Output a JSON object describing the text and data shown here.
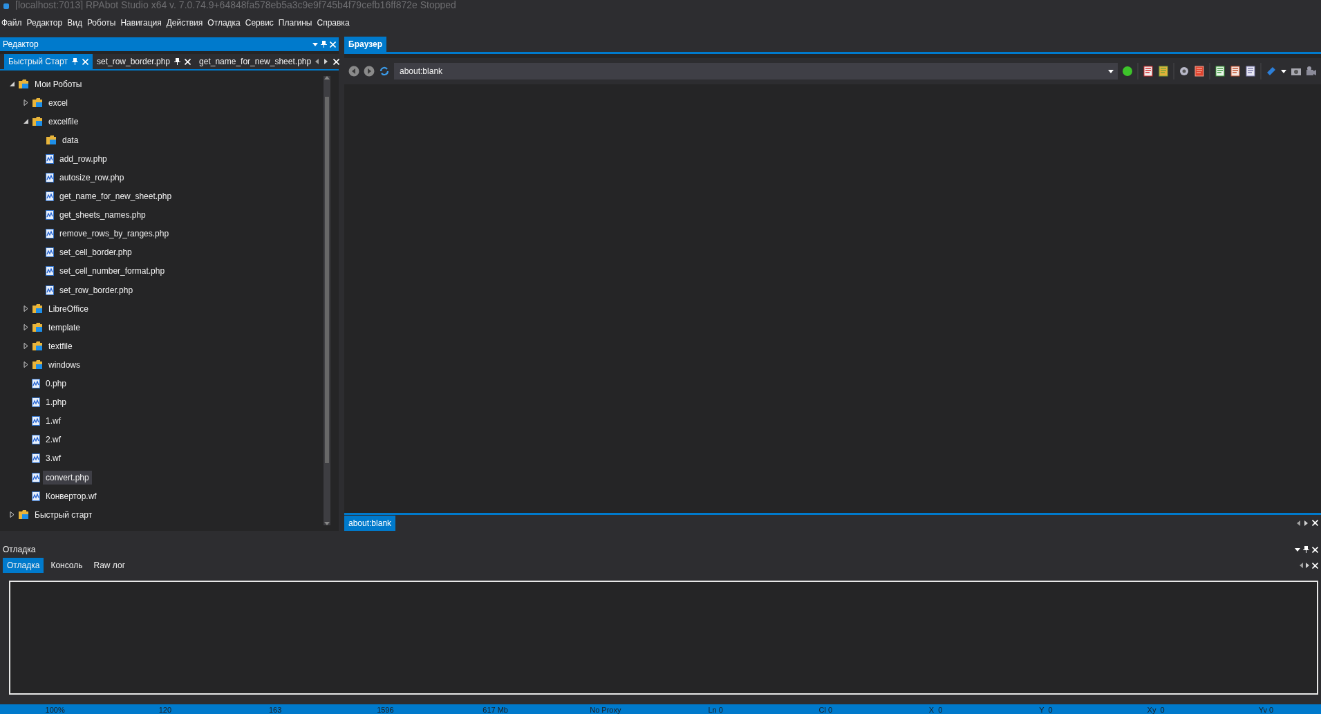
{
  "window": {
    "title": "[localhost:7013] RPAbot Studio x64 v. 7.0.74.9+64848fa578eb5a3c9e9f745b4f79cefb16ff872e Stopped"
  },
  "menu": [
    "Файл",
    "Редактор",
    "Вид",
    "Роботы",
    "Навигация",
    "Действия",
    "Отладка",
    "Сервис",
    "Плагины",
    "Справка"
  ],
  "editor": {
    "title": "Редактор",
    "tabs": [
      {
        "label": "Быстрый Старт",
        "selected": true,
        "pinned": true,
        "closable": true
      },
      {
        "label": "set_row_border.php",
        "selected": false,
        "pinned": true,
        "closable": true
      },
      {
        "label": "get_name_for_new_sheet.php",
        "selected": false,
        "pinned": false,
        "closable": false
      }
    ],
    "tree": [
      {
        "label": "Мои Роботы",
        "kind": "folder",
        "expanded": true,
        "selected": false,
        "children": [
          {
            "label": "excel",
            "kind": "folder",
            "expanded": false,
            "selected": false
          },
          {
            "label": "excelfile",
            "kind": "folder",
            "expanded": true,
            "selected": false,
            "children": [
              {
                "label": "data",
                "kind": "folder",
                "selected": false
              },
              {
                "label": "add_row.php",
                "kind": "file",
                "selected": false
              },
              {
                "label": "autosize_row.php",
                "kind": "file",
                "selected": false
              },
              {
                "label": "get_name_for_new_sheet.php",
                "kind": "file",
                "selected": false
              },
              {
                "label": "get_sheets_names.php",
                "kind": "file",
                "selected": false
              },
              {
                "label": "remove_rows_by_ranges.php",
                "kind": "file",
                "selected": false
              },
              {
                "label": "set_cell_border.php",
                "kind": "file",
                "selected": false
              },
              {
                "label": "set_cell_number_format.php",
                "kind": "file",
                "selected": false
              },
              {
                "label": "set_row_border.php",
                "kind": "file",
                "selected": false
              }
            ]
          },
          {
            "label": "LibreOffice",
            "kind": "folder",
            "expanded": false,
            "selected": false
          },
          {
            "label": "template",
            "kind": "folder",
            "expanded": false,
            "selected": false
          },
          {
            "label": "textfile",
            "kind": "folder",
            "expanded": false,
            "selected": false
          },
          {
            "label": "windows",
            "kind": "folder",
            "expanded": false,
            "selected": false
          },
          {
            "label": "0.php",
            "kind": "file",
            "selected": false
          },
          {
            "label": "1.php",
            "kind": "file",
            "selected": false
          },
          {
            "label": "1.wf",
            "kind": "file",
            "selected": false
          },
          {
            "label": "2.wf",
            "kind": "file",
            "selected": false
          },
          {
            "label": "3.wf",
            "kind": "file",
            "selected": false
          },
          {
            "label": "convert.php",
            "kind": "file",
            "selected": true
          },
          {
            "label": "Конвертор.wf",
            "kind": "file",
            "selected": false
          }
        ]
      },
      {
        "label": "Быстрый старт",
        "kind": "folder",
        "expanded": false,
        "selected": false
      }
    ]
  },
  "browser": {
    "tabs": [
      {
        "label": "Браузер",
        "selected": true
      }
    ],
    "address": "about:blank",
    "bottom_tabs": [
      {
        "label": "about:blank",
        "selected": true
      }
    ]
  },
  "debug": {
    "title": "Отладка",
    "tabs": [
      {
        "label": "Отладка",
        "selected": true
      },
      {
        "label": "Консоль",
        "selected": false
      },
      {
        "label": "Raw лог",
        "selected": false
      }
    ]
  },
  "status_bar": [
    "100%",
    "120",
    "163",
    "1596",
    "617 Mb",
    "No Proxy",
    "Ln 0",
    "Cl 0",
    "X  0",
    "Y  0",
    "Xy  0",
    "Yv 0"
  ]
}
